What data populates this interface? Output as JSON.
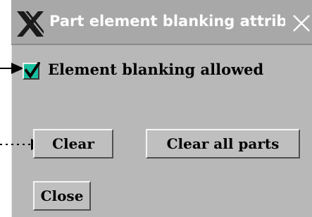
{
  "window": {
    "title": "Part element blanking attribu",
    "logo_icon": "x-window-logo-icon",
    "close_icon": "close-icon"
  },
  "checkbox": {
    "label": "Element blanking allowed",
    "checked": true,
    "color": "#18c0a0"
  },
  "buttons": {
    "clear_label": "Clear",
    "clear_all_label": "Clear all parts",
    "close_label": "Close"
  },
  "annotations": {
    "arrow_1_icon": "pointer-arrow-icon",
    "arrow_2_icon": "dashed-pointer-arrow-icon"
  },
  "colors": {
    "dialog_bg": "#b8b8b8",
    "titlebar_bg": "#a8a8a8",
    "title_text": "#ffffff"
  }
}
